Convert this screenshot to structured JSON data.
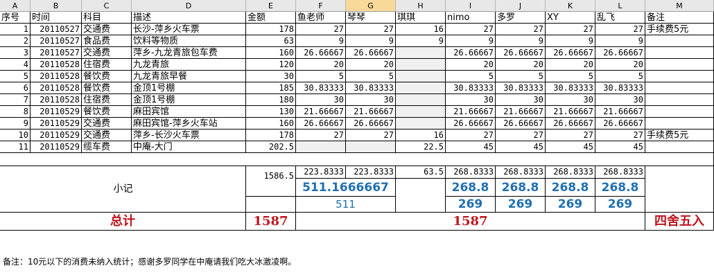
{
  "columns": [
    "A",
    "B",
    "C",
    "D",
    "E",
    "F",
    "G",
    "H",
    "I",
    "J",
    "K",
    "L",
    "M"
  ],
  "header": [
    "序号",
    "时间",
    "科目",
    "描述",
    "金额",
    "鱼老师",
    "琴琴",
    "琪琪",
    "nimo",
    "多罗",
    "XY",
    "乱飞",
    "备注"
  ],
  "rows": [
    [
      "1",
      "20110527",
      "交通费",
      "长沙-萍乡火车票",
      "178",
      "27",
      "27",
      "16",
      "27",
      "27",
      "27",
      "27",
      "手续费5元"
    ],
    [
      "2",
      "20110527",
      "食品费",
      "饮料等物质",
      "63",
      "9",
      "9",
      "9",
      "9",
      "9",
      "9",
      "9",
      ""
    ],
    [
      "3",
      "20110527",
      "交通费",
      "萍乡-九龙青旅包车费",
      "160",
      "26.66667",
      "26.66667",
      "",
      "26.66667",
      "26.66667",
      "26.66667",
      "26.66667",
      ""
    ],
    [
      "4",
      "20110528",
      "住宿费",
      "九龙青旅",
      "120",
      "20",
      "20",
      "",
      "20",
      "20",
      "20",
      "20",
      ""
    ],
    [
      "5",
      "20110528",
      "餐饮费",
      "九龙青旅早餐",
      "30",
      "5",
      "5",
      "",
      "5",
      "5",
      "5",
      "5",
      ""
    ],
    [
      "6",
      "20110528",
      "餐饮费",
      "金顶1号棚",
      "185",
      "30.83333",
      "30.83333",
      "",
      "30.83333",
      "30.83333",
      "30.83333",
      "30.83333",
      ""
    ],
    [
      "7",
      "20110528",
      "住宿费",
      "金顶1号棚",
      "180",
      "30",
      "30",
      "",
      "30",
      "30",
      "30",
      "30",
      ""
    ],
    [
      "8",
      "20110529",
      "餐饮费",
      "麻田宾馆",
      "130",
      "21.66667",
      "21.66667",
      "",
      "21.66667",
      "21.66667",
      "21.66667",
      "21.66667",
      ""
    ],
    [
      "9",
      "20110529",
      "交通费",
      "麻田宾馆-萍乡火车站",
      "160",
      "26.66667",
      "26.66667",
      "",
      "26.66667",
      "26.66667",
      "26.66667",
      "26.66667",
      ""
    ],
    [
      "10",
      "20110529",
      "交通费",
      "萍乡-长沙火车票",
      "178",
      "27",
      "27",
      "16",
      "27",
      "27",
      "27",
      "27",
      "手续费5元"
    ],
    [
      "11",
      "20110529",
      "缆车费",
      "中庵-大门",
      "202.5",
      "",
      "",
      "22.5",
      "45",
      "45",
      "45",
      "45",
      ""
    ]
  ],
  "subtotal": {
    "label": "小记",
    "total": "1586.5",
    "line1": [
      "223.8333",
      "223.8333",
      "63.5",
      "268.8333",
      "268.8333",
      "268.8333",
      "268.8333"
    ],
    "fg_merged": "511.1666667",
    "line2": [
      "268.8",
      "268.8",
      "268.8",
      "268.8"
    ],
    "fg_round": "511",
    "line3": [
      "269",
      "269",
      "269",
      "269"
    ]
  },
  "grand": {
    "label": "总计",
    "left": "1587",
    "mid": "1587",
    "remark": "四舍五入"
  },
  "note": "备注：10元以下的消费未纳入统计；感谢多罗同学在中庵请我们吃大冰激凌啊。"
}
